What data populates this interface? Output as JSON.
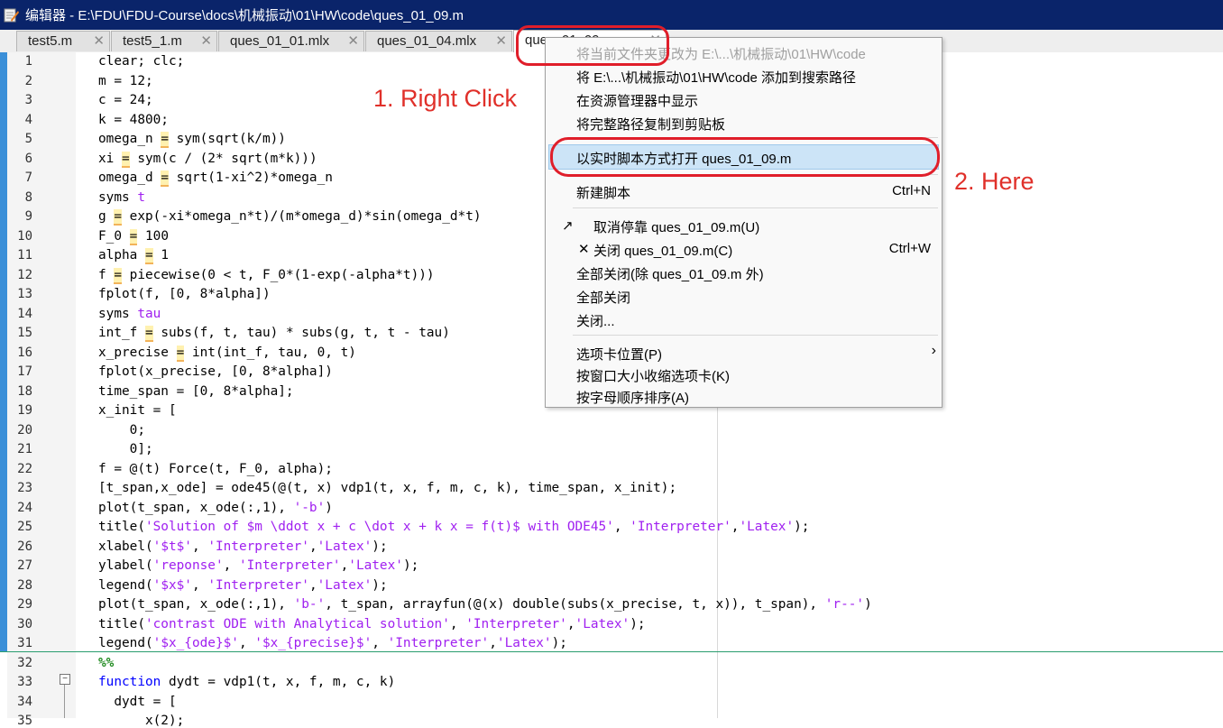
{
  "window": {
    "title": "编辑器 - E:\\FDU\\FDU-Course\\docs\\机械振动\\01\\HW\\code\\ques_01_09.m"
  },
  "tabs": [
    {
      "label": "test5.m",
      "close": "✕"
    },
    {
      "label": "test5_1.m",
      "close": "✕"
    },
    {
      "label": "ques_01_01.mlx",
      "close": "✕"
    },
    {
      "label": "ques_01_04.mlx",
      "close": "✕"
    },
    {
      "label": "ques_01_09.m",
      "close": "✕"
    }
  ],
  "line_numbers": [
    "1",
    "2",
    "3",
    "4",
    "5",
    "6",
    "7",
    "8",
    "9",
    "10",
    "11",
    "12",
    "13",
    "14",
    "15",
    "16",
    "17",
    "18",
    "19",
    "20",
    "21",
    "22",
    "23",
    "24",
    "25",
    "26",
    "27",
    "28",
    "29",
    "30",
    "31",
    "32",
    "33",
    "34",
    "35"
  ],
  "code": {
    "l1": "clear; clc;",
    "l2": "m = 12;",
    "l3": "c = 24;",
    "l4": "k = 4800;",
    "l5a": "omega_n ",
    "l5b": "=",
    "l5c": " sym(sqrt(k/m))",
    "l6a": "xi ",
    "l6b": "=",
    "l6c": " sym(c / (2* sqrt(m*k)))",
    "l7a": "omega_d ",
    "l7b": "=",
    "l7c": " sqrt(1-xi^2)*omega_n",
    "l8a": "syms ",
    "l8b": "t",
    "l9a": "g ",
    "l9b": "=",
    "l9c": " exp(-xi*omega_n*t)/(m*omega_d)*sin(omega_d*t)",
    "l10a": "F_0 ",
    "l10b": "=",
    "l10c": " 100",
    "l11a": "alpha ",
    "l11b": "=",
    "l11c": " 1",
    "l12a": "f ",
    "l12b": "=",
    "l12c": " piecewise(0 < t, F_0*(1-exp(-alpha*t)))",
    "l13": "fplot(f, [0, 8*alpha])",
    "l14a": "syms ",
    "l14b": "tau",
    "l15a": "int_f ",
    "l15b": "=",
    "l15c": " subs(f, t, tau) * subs(g, t, t - tau)",
    "l16a": "x_precise ",
    "l16b": "=",
    "l16c": " int(int_f, tau, 0, t)",
    "l17": "fplot(x_precise, [0, 8*alpha])",
    "l18": "time_span = [0, 8*alpha];",
    "l19": "x_init = [",
    "l20": "    0;",
    "l21": "    0];",
    "l22": "f = @(t) Force(t, F_0, alpha);",
    "l23": "[t_span,x_ode] = ode45(@(t, x) vdp1(t, x, f, m, c, k), time_span, x_init);",
    "l24a": "plot(t_span, x_ode(:,1), ",
    "l24b": "'-b'",
    "l24c": ")",
    "l25a": "title(",
    "l25b": "'Solution of $m \\ddot x + c \\dot x + k x = f(t)$ with ODE45'",
    "l25c": ", ",
    "l25d": "'Interpreter'",
    "l25e": ",",
    "l25f": "'Latex'",
    "l25g": ");",
    "l26a": "xlabel(",
    "l26b": "'$t$'",
    "l26c": ", ",
    "l26d": "'Interpreter'",
    "l26e": ",",
    "l26f": "'Latex'",
    "l26g": ");",
    "l27a": "ylabel(",
    "l27b": "'reponse'",
    "l27c": ", ",
    "l27d": "'Interpreter'",
    "l27e": ",",
    "l27f": "'Latex'",
    "l27g": ");",
    "l28a": "legend(",
    "l28b": "'$x$'",
    "l28c": ", ",
    "l28d": "'Interpreter'",
    "l28e": ",",
    "l28f": "'Latex'",
    "l28g": ");",
    "l29a": "plot(t_span, x_ode(:,1), ",
    "l29b": "'b-'",
    "l29c": ", t_span, arrayfun(@(x) double(subs(x_precise, t, x)), t_span), ",
    "l29d": "'r--'",
    "l29e": ")",
    "l30a": "title(",
    "l30b": "'contrast ODE with Analytical solution'",
    "l30c": ", ",
    "l30d": "'Interpreter'",
    "l30e": ",",
    "l30f": "'Latex'",
    "l30g": ");",
    "l31a": "legend(",
    "l31b": "'$x_{ode}$'",
    "l31c": ", ",
    "l31d": "'$x_{precise}$'",
    "l31e": ", ",
    "l31f": "'Interpreter'",
    "l31g": ",",
    "l31h": "'Latex'",
    "l31i": ");",
    "l32": "%%",
    "l33a": "function",
    "l33b": " dydt = vdp1(t, x, f, m, c, k)",
    "l34": "  dydt = [",
    "l35": "      x(2);"
  },
  "context_menu": {
    "items": [
      "将当前文件夹更改为 E:\\...\\机械振动\\01\\HW\\code",
      "将 E:\\...\\机械振动\\01\\HW\\code 添加到搜索路径",
      "在资源管理器中显示",
      "将完整路径复制到剪贴板",
      "以实时脚本方式打开 ques_01_09.m",
      "新建脚本",
      "取消停靠 ques_01_09.m(U)",
      "关闭 ques_01_09.m(C)",
      "全部关闭(除 ques_01_09.m 外)",
      "全部关闭",
      "关闭...",
      "选项卡位置(P)",
      "按窗口大小收缩选项卡(K)",
      "按字母顺序排序(A)"
    ],
    "shortcuts": {
      "new_script": "Ctrl+N",
      "close": "Ctrl+W"
    },
    "undock_glyph": "↗",
    "close_glyph": "✕",
    "submenu_arrow": "›"
  },
  "annotations": {
    "step1": "1. Right Click",
    "step2": "2. Here"
  },
  "colors": {
    "title_bg": "#0a246a",
    "string": "#a020f0",
    "keyword": "#0000ff",
    "annotation": "#e0302a",
    "highlight": "#cce4f7"
  },
  "icons": [
    "matlab-editor-icon",
    "close-icon",
    "fold-minus-icon",
    "undock-icon",
    "submenu-arrow-icon"
  ]
}
